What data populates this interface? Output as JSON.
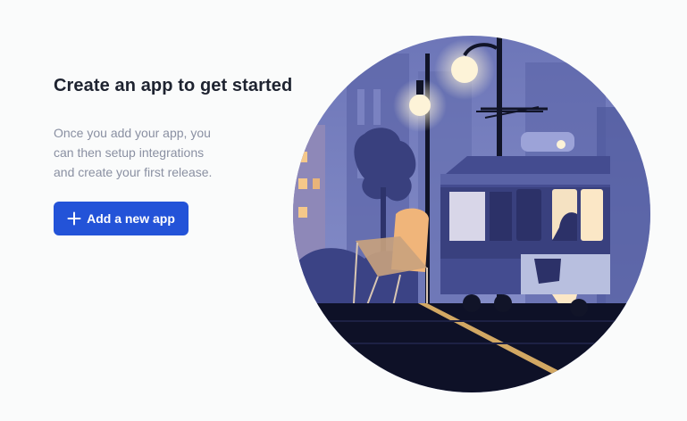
{
  "empty_state": {
    "title": "Create an app to get started",
    "description_lines": [
      "Once you add your app, you",
      "can then setup integrations",
      "and create your first release."
    ],
    "primary_button": {
      "label": "Add a new app",
      "icon": "plus-icon"
    },
    "illustration": {
      "subject": "tram-street-night-illustration",
      "colors": {
        "sky": "#7d85c4",
        "tram_body": "#444c90",
        "window_light": "#fbe7c6",
        "lamp": "#fdf3d8",
        "chair": "#f0b57a",
        "ground": "#0e1127"
      }
    },
    "colors": {
      "background": "#fafbfb",
      "title": "#1e2330",
      "body_text": "#8a90a2",
      "primary": "#2353d8"
    }
  }
}
